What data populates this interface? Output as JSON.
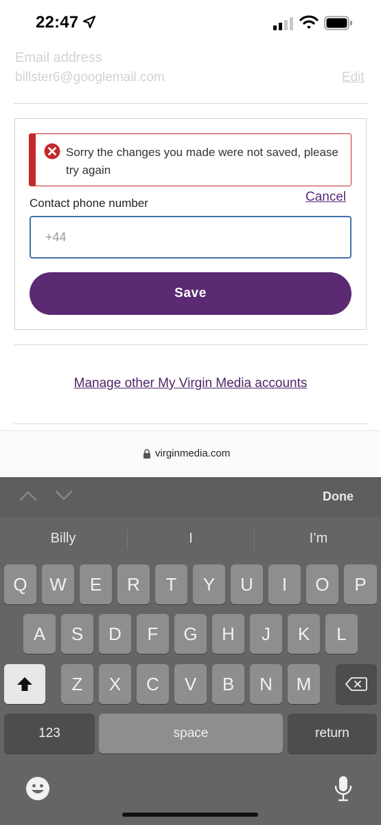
{
  "status_bar": {
    "time": "22:47"
  },
  "account": {
    "email_label": "Email address",
    "email_value": "billster6@googlemail.com",
    "edit_label": "Edit"
  },
  "edit_panel": {
    "error_message": "Sorry the changes you made were not saved, please try again",
    "cancel_label": "Cancel",
    "phone_label": "Contact phone number",
    "phone_placeholder": "+44",
    "save_label": "Save"
  },
  "manage_link": "Manage other My Virgin Media accounts",
  "browser": {
    "url": "virginmedia.com"
  },
  "keyboard": {
    "done_label": "Done",
    "suggestions": [
      "Billy",
      "I",
      "I’m"
    ],
    "row1": [
      "Q",
      "W",
      "E",
      "R",
      "T",
      "Y",
      "U",
      "I",
      "O",
      "P"
    ],
    "row2": [
      "A",
      "S",
      "D",
      "F",
      "G",
      "H",
      "J",
      "K",
      "L"
    ],
    "row3": [
      "Z",
      "X",
      "C",
      "V",
      "B",
      "N",
      "M"
    ],
    "numbers_label": "123",
    "space_label": "space",
    "return_label": "return"
  },
  "colors": {
    "brand_purple": "#5b2a73",
    "error_red": "#c4292d",
    "input_border": "#3f72a8"
  }
}
